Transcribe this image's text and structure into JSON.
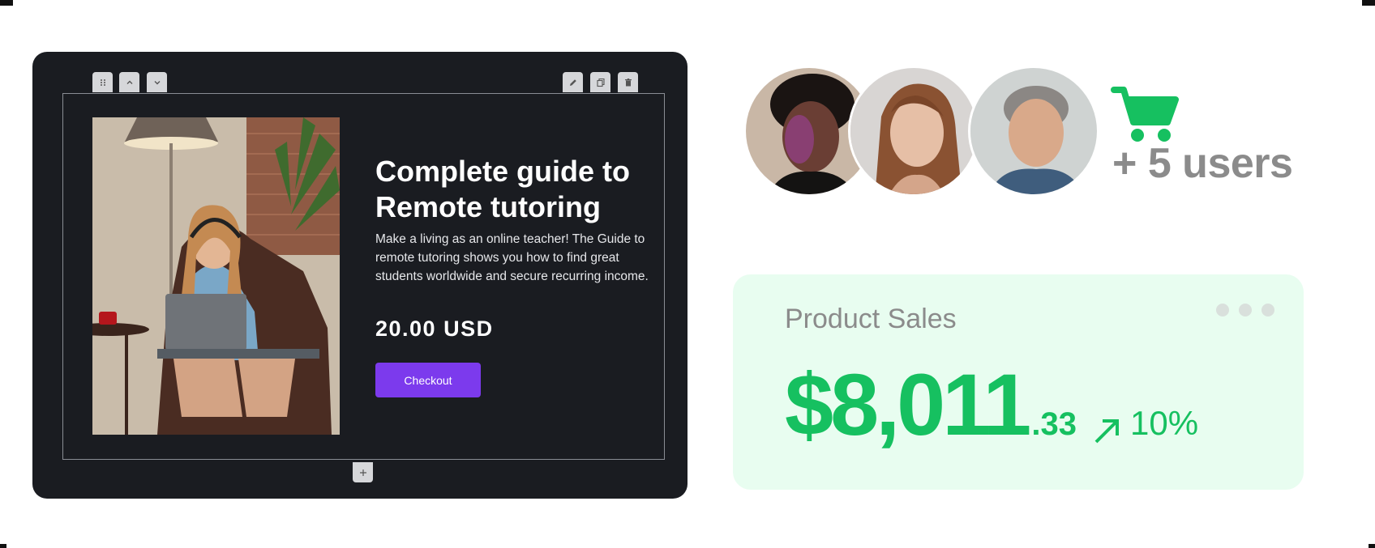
{
  "product": {
    "title": "Complete guide to Remote tutoring",
    "description": "Make a living as an online teacher! The Guide to remote tutoring shows you how to find great students worldwide and secure recurring income.",
    "price": "20.00 USD",
    "checkout_label": "Checkout"
  },
  "toolbar": {
    "left_icons": [
      "drag-handle-icon",
      "chevron-up-icon",
      "chevron-down-icon"
    ],
    "right_icons": [
      "pencil-icon",
      "copy-icon",
      "trash-icon"
    ],
    "add_icon": "plus-icon"
  },
  "users": {
    "count_text": "+ 5 users",
    "icon": "shopping-cart-icon",
    "icon_color": "#16c060"
  },
  "sales": {
    "label": "Product Sales",
    "amount_main": "$8,011",
    "amount_cents": ".33",
    "trend_value": "10%",
    "trend_icon": "arrow-up-right-icon",
    "accent_color": "#16c060",
    "card_bg": "#e8fdf0"
  },
  "colors": {
    "editor_bg": "#1a1c21",
    "checkout_bg": "#7c3aed"
  }
}
